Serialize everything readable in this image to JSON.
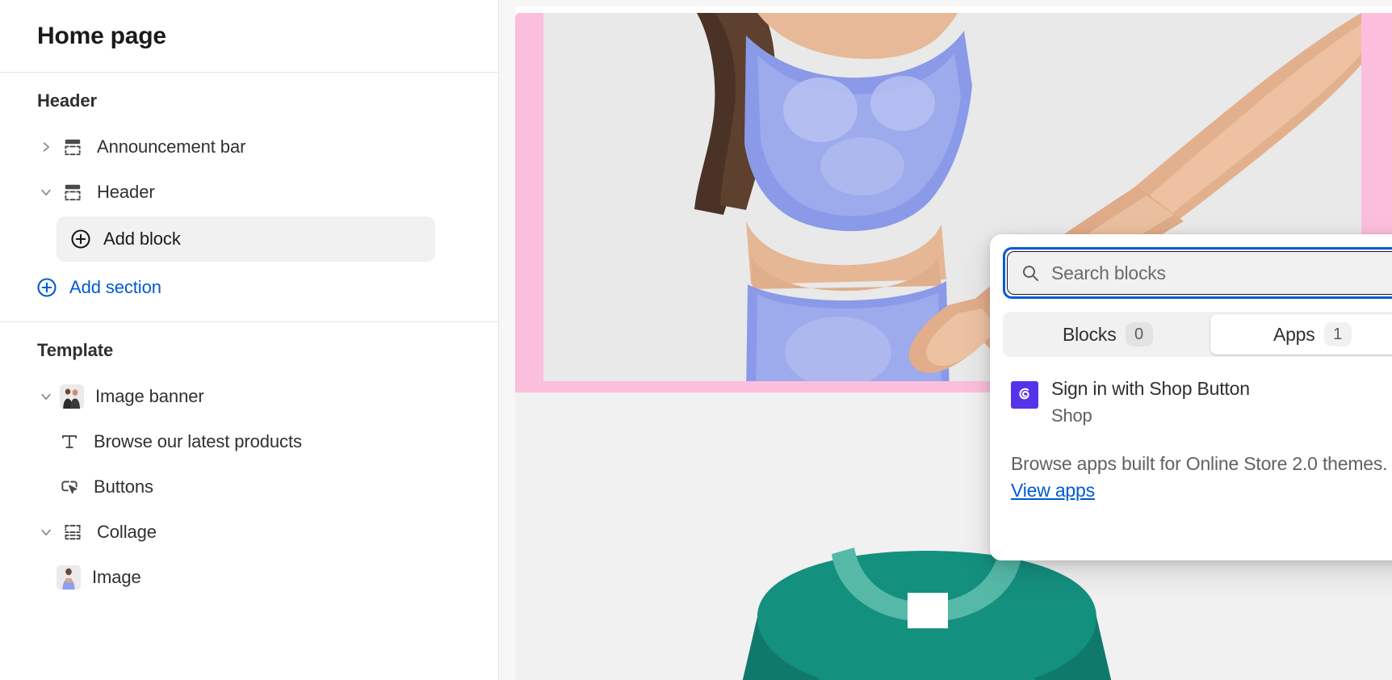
{
  "sidebar": {
    "title": "Home page",
    "sections": [
      {
        "label": "Header",
        "items": [
          {
            "label": "Announcement bar",
            "icon": "section-icon",
            "chevron": "chevron-right-icon",
            "indent": 1
          },
          {
            "label": "Header",
            "icon": "section-icon",
            "chevron": "chevron-down-icon",
            "indent": 1
          }
        ],
        "add_block_label": "Add block",
        "add_section_label": "Add section"
      },
      {
        "label": "Template",
        "items": [
          {
            "label": "Image banner",
            "icon": "image-thumbnail",
            "chevron": "chevron-down-icon",
            "indent": 1
          },
          {
            "label": "Browse our latest products",
            "icon": "text-icon",
            "chevron": "",
            "indent": 2
          },
          {
            "label": "Buttons",
            "icon": "button-icon",
            "chevron": "",
            "indent": 2
          },
          {
            "label": "Collage",
            "icon": "collage-icon",
            "chevron": "chevron-down-icon",
            "indent": 1
          },
          {
            "label": "Image",
            "icon": "image-thumbnail",
            "chevron": "",
            "indent": 2
          }
        ]
      }
    ]
  },
  "popover": {
    "search": {
      "placeholder": "Search blocks",
      "value": "",
      "icon": "search-icon"
    },
    "tabs": [
      {
        "label": "Blocks",
        "count": "0",
        "active": false
      },
      {
        "label": "Apps",
        "count": "1",
        "active": true
      }
    ],
    "results": [
      {
        "title": "Sign in with Shop Button",
        "subtitle": "Shop",
        "icon": "shop-app-icon"
      }
    ],
    "footer_text_before": "Browse apps built for Online Store 2.0 themes. ",
    "footer_link": "View apps"
  },
  "preview": {
    "banner_background": "#e9e9e9",
    "accent_band_color": "#fcbedd",
    "lower_background": "#f1f1f1",
    "shirt_color": "#1a8f7e"
  }
}
